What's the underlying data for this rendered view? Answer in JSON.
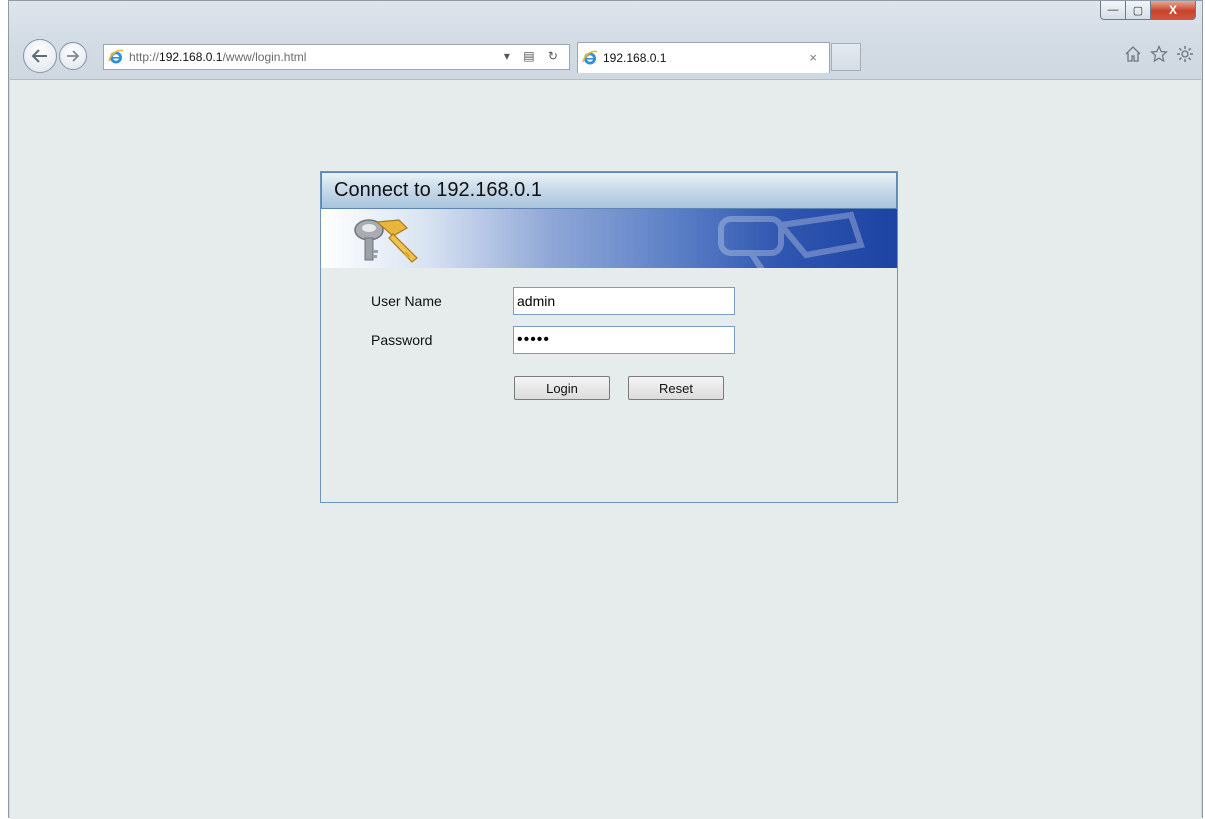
{
  "browser": {
    "address_prefix": "http://",
    "address_host": "192.168.0.1",
    "address_path": "/www/login.html",
    "address_tools": "▾ ▤ ↻",
    "tab_title": "192.168.0.1",
    "tab_close": "×",
    "window_buttons": {
      "minimize": "—",
      "maximize": "▢",
      "close": "X"
    },
    "icons": [
      "home-icon",
      "favorites-star-icon",
      "tools-gear-icon"
    ]
  },
  "login": {
    "title": "Connect to 192.168.0.1",
    "username_label": "User Name",
    "username_value": "admin",
    "password_label": "Password",
    "password_value": "•••••",
    "login_button": "Login",
    "reset_button": "Reset"
  },
  "colors": {
    "content_bg": "#e6ebeb",
    "panel_border": "#6e93bc",
    "banner_dark": "#1d43a3"
  }
}
